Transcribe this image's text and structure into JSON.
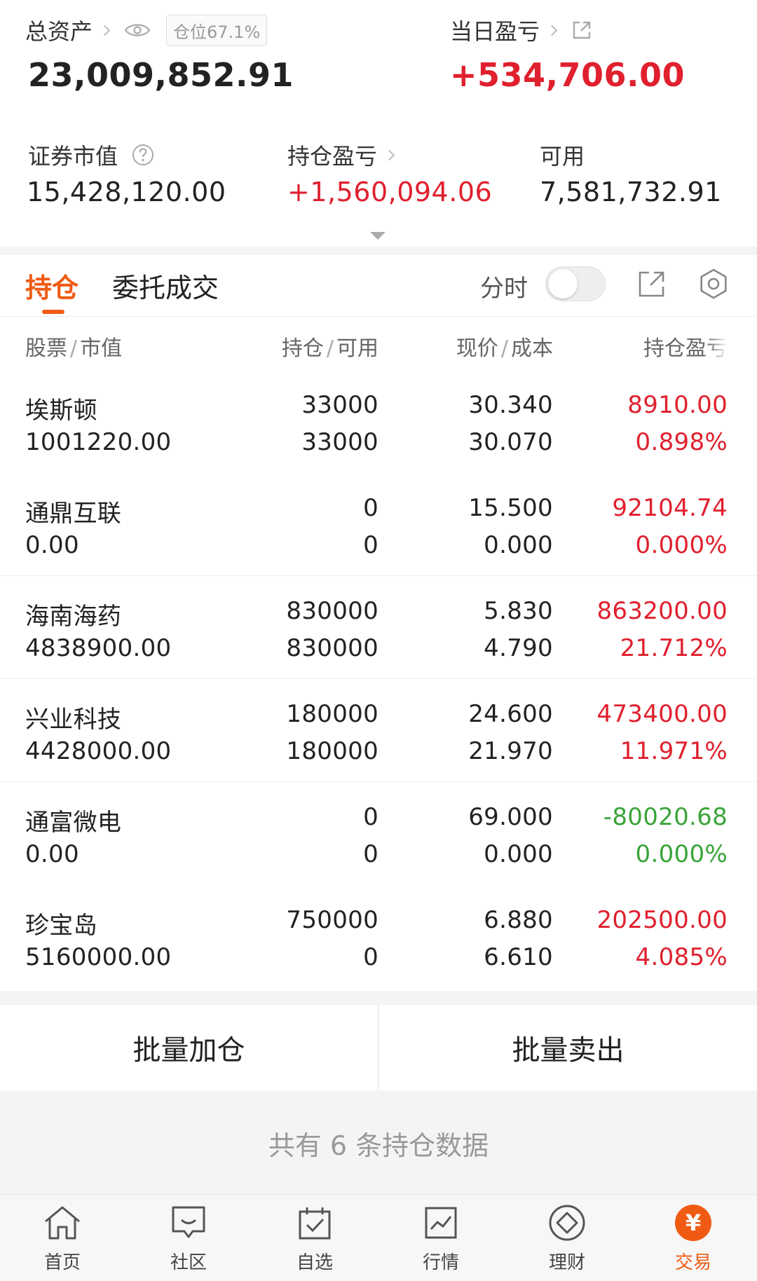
{
  "summary": {
    "total_assets_label": "总资产",
    "position_badge": "仓位67.1%",
    "total_assets_value": "23,009,852.91",
    "daily_pl_label": "当日盈亏",
    "daily_pl_value": "+534,706.00",
    "market_value_label": "证券市值",
    "market_value_value": "15,428,120.00",
    "holding_pl_label": "持仓盈亏",
    "holding_pl_value": "+1,560,094.06",
    "available_label": "可用",
    "available_value": "7,581,732.91"
  },
  "tabs": {
    "active": "持仓",
    "other": "委托成交",
    "timeshare_label": "分时",
    "timeshare_on": false
  },
  "table": {
    "headers": {
      "stock": "股票",
      "market_value": "市值",
      "holding": "持仓",
      "available": "可用",
      "price": "现价",
      "cost": "成本",
      "pl": "持仓盈亏"
    },
    "rows": [
      {
        "name": "埃斯顿",
        "value": "1001220.00",
        "holding": "33000",
        "available": "33000",
        "price": "30.340",
        "cost": "30.070",
        "pl": "8910.00",
        "pl_pct": "0.898%",
        "tone": "up"
      },
      {
        "name": "通鼎互联",
        "value": "0.00",
        "holding": "0",
        "available": "0",
        "price": "15.500",
        "cost": "0.000",
        "pl": "92104.74",
        "pl_pct": "0.000%",
        "tone": "up"
      },
      {
        "name": "海南海药",
        "value": "4838900.00",
        "holding": "830000",
        "available": "830000",
        "price": "5.830",
        "cost": "4.790",
        "pl": "863200.00",
        "pl_pct": "21.712%",
        "tone": "up"
      },
      {
        "name": "兴业科技",
        "value": "4428000.00",
        "holding": "180000",
        "available": "180000",
        "price": "24.600",
        "cost": "21.970",
        "pl": "473400.00",
        "pl_pct": "11.971%",
        "tone": "up"
      },
      {
        "name": "通富微电",
        "value": "0.00",
        "holding": "0",
        "available": "0",
        "price": "69.000",
        "cost": "0.000",
        "pl": "-80020.68",
        "pl_pct": "0.000%",
        "tone": "down"
      },
      {
        "name": "珍宝岛",
        "value": "5160000.00",
        "holding": "750000",
        "available": "0",
        "price": "6.880",
        "cost": "6.610",
        "pl": "202500.00",
        "pl_pct": "4.085%",
        "tone": "up"
      }
    ]
  },
  "actions": {
    "batch_add": "批量加仓",
    "batch_sell": "批量卖出"
  },
  "footer": {
    "count_text": "共有 6 条持仓数据"
  },
  "nav": {
    "items": [
      "首页",
      "社区",
      "自选",
      "行情",
      "理财",
      "交易"
    ],
    "trade_glyph": "¥"
  },
  "colors": {
    "accent": "#f05b14",
    "up": "#e0202e",
    "down": "#3aa43a"
  },
  "icons": [
    "eye-icon",
    "external-link-icon",
    "help-icon",
    "chevron-right-icon",
    "collapse-arrow-icon",
    "share-icon",
    "gear-icon",
    "home-icon",
    "community-icon",
    "watchlist-icon",
    "market-icon",
    "wealth-icon",
    "trade-icon"
  ]
}
